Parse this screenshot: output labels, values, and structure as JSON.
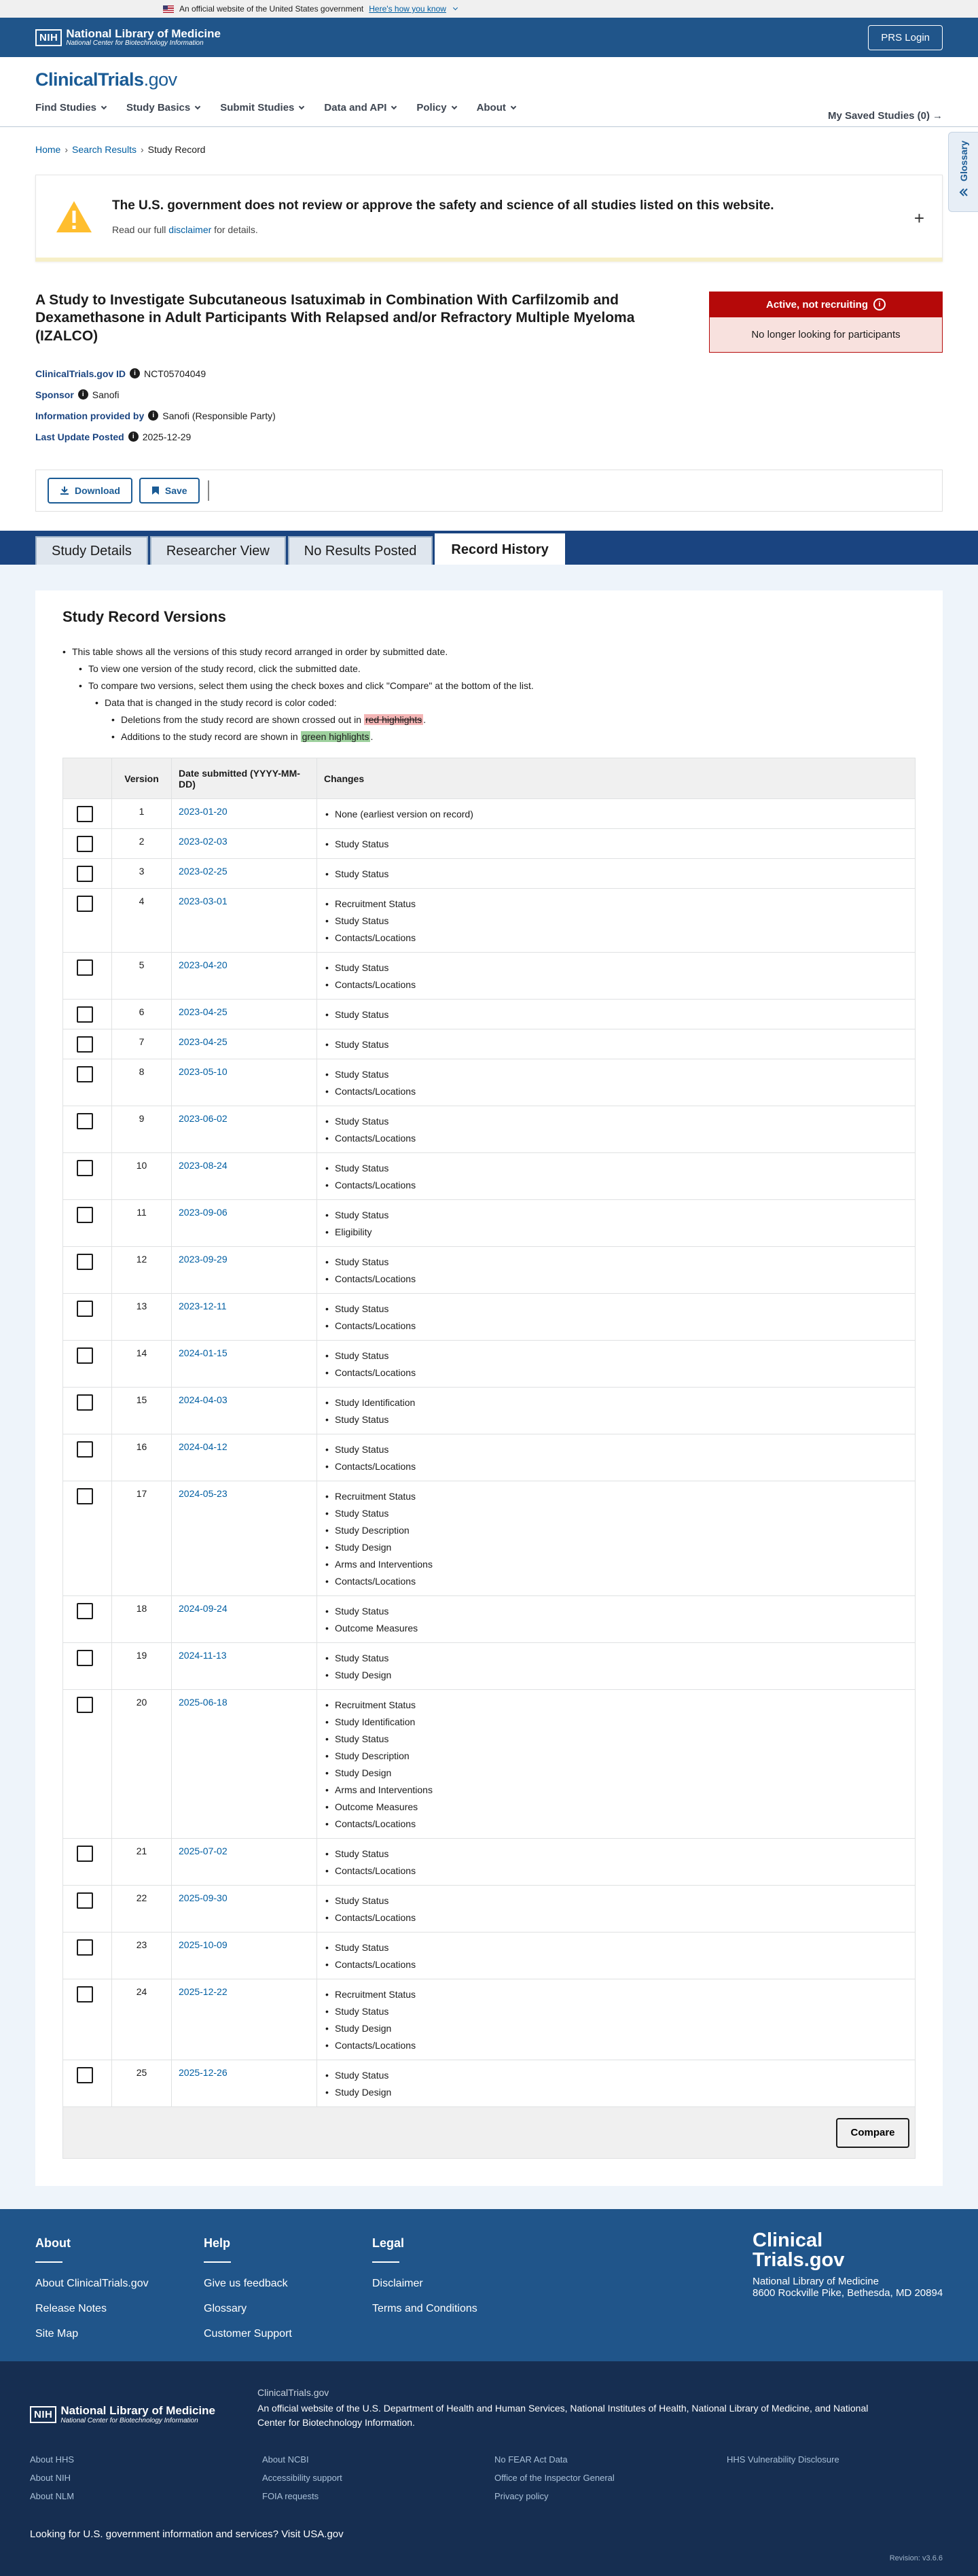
{
  "gov_banner": {
    "text": "An official website of the United States government",
    "link": "Here's how you know"
  },
  "nlm": {
    "nih": "NIH",
    "title": "National Library of Medicine",
    "subtitle": "National Center for Biotechnology Information",
    "prs_button": "PRS Login"
  },
  "ct": {
    "logo_main": "ClinicalTrials",
    "logo_gov": ".gov",
    "nav": [
      "Find Studies",
      "Study Basics",
      "Submit Studies",
      "Data and API",
      "Policy",
      "About"
    ],
    "saved": "My Saved Studies (0)",
    "saved_arrow": "→",
    "glossary": "Glossary"
  },
  "breadcrumb": {
    "home": "Home",
    "search": "Search Results",
    "current": "Study Record"
  },
  "alert": {
    "title": "The U.S. government does not review or approve the safety and science of all studies listed on this website.",
    "pre": "Read our full ",
    "link": "disclaimer",
    "post": " for details.",
    "expand": "+"
  },
  "study": {
    "title": "A Study to Investigate Subcutaneous Isatuximab in Combination With Carfilzomib and Dexamethasone in Adult Participants With Relapsed and/or Refractory Multiple Myeloma (IZALCO)",
    "status": "Active, not recruiting",
    "status_sub": "No longer looking for participants",
    "id_label": "ClinicalTrials.gov ID",
    "id_value": "NCT05704049",
    "sponsor_label": "Sponsor",
    "sponsor_value": "Sanofi",
    "info_label": "Information provided by",
    "info_value": "Sanofi (Responsible Party)",
    "update_label": "Last Update Posted",
    "update_value": "2025-12-29"
  },
  "actions": {
    "download": "Download",
    "save": "Save"
  },
  "tabs": [
    "Study Details",
    "Researcher View",
    "No Results Posted",
    "Record History"
  ],
  "versions_section": {
    "heading": "Study Record Versions",
    "intro1": "This table shows all the versions of this study record arranged in order by submitted date.",
    "intro2": "To view one version of the study record, click the submitted date.",
    "intro3": "To compare two versions, select them using the check boxes and click \"Compare\" at the bottom of the list.",
    "intro4": "Data that is changed in the study record is color coded:",
    "intro5_pre": "Deletions from the study record are shown crossed out in ",
    "intro5_hl": "red highlights",
    "intro5_post": ".",
    "intro6_pre": "Additions to the study record are shown in ",
    "intro6_hl": "green highlights",
    "intro6_post": ".",
    "col_version": "Version",
    "col_date": "Date submitted (YYYY-MM-DD)",
    "col_changes": "Changes",
    "compare": "Compare",
    "rows": [
      {
        "v": "1",
        "d": "2023-01-20",
        "c": [
          "None (earliest version on record)"
        ]
      },
      {
        "v": "2",
        "d": "2023-02-03",
        "c": [
          "Study Status"
        ]
      },
      {
        "v": "3",
        "d": "2023-02-25",
        "c": [
          "Study Status"
        ]
      },
      {
        "v": "4",
        "d": "2023-03-01",
        "c": [
          "Recruitment Status",
          "Study Status",
          "Contacts/Locations"
        ]
      },
      {
        "v": "5",
        "d": "2023-04-20",
        "c": [
          "Study Status",
          "Contacts/Locations"
        ]
      },
      {
        "v": "6",
        "d": "2023-04-25",
        "c": [
          "Study Status"
        ]
      },
      {
        "v": "7",
        "d": "2023-04-25",
        "c": [
          "Study Status"
        ]
      },
      {
        "v": "8",
        "d": "2023-05-10",
        "c": [
          "Study Status",
          "Contacts/Locations"
        ]
      },
      {
        "v": "9",
        "d": "2023-06-02",
        "c": [
          "Study Status",
          "Contacts/Locations"
        ]
      },
      {
        "v": "10",
        "d": "2023-08-24",
        "c": [
          "Study Status",
          "Contacts/Locations"
        ]
      },
      {
        "v": "11",
        "d": "2023-09-06",
        "c": [
          "Study Status",
          "Eligibility"
        ]
      },
      {
        "v": "12",
        "d": "2023-09-29",
        "c": [
          "Study Status",
          "Contacts/Locations"
        ]
      },
      {
        "v": "13",
        "d": "2023-12-11",
        "c": [
          "Study Status",
          "Contacts/Locations"
        ]
      },
      {
        "v": "14",
        "d": "2024-01-15",
        "c": [
          "Study Status",
          "Contacts/Locations"
        ]
      },
      {
        "v": "15",
        "d": "2024-04-03",
        "c": [
          "Study Identification",
          "Study Status"
        ]
      },
      {
        "v": "16",
        "d": "2024-04-12",
        "c": [
          "Study Status",
          "Contacts/Locations"
        ]
      },
      {
        "v": "17",
        "d": "2024-05-23",
        "c": [
          "Recruitment Status",
          "Study Status",
          "Study Description",
          "Study Design",
          "Arms and Interventions",
          "Contacts/Locations"
        ]
      },
      {
        "v": "18",
        "d": "2024-09-24",
        "c": [
          "Study Status",
          "Outcome Measures"
        ]
      },
      {
        "v": "19",
        "d": "2024-11-13",
        "c": [
          "Study Status",
          "Study Design"
        ]
      },
      {
        "v": "20",
        "d": "2025-06-18",
        "c": [
          "Recruitment Status",
          "Study Identification",
          "Study Status",
          "Study Description",
          "Study Design",
          "Arms and Interventions",
          "Outcome Measures",
          "Contacts/Locations"
        ]
      },
      {
        "v": "21",
        "d": "2025-07-02",
        "c": [
          "Study Status",
          "Contacts/Locations"
        ]
      },
      {
        "v": "22",
        "d": "2025-09-30",
        "c": [
          "Study Status",
          "Contacts/Locations"
        ]
      },
      {
        "v": "23",
        "d": "2025-10-09",
        "c": [
          "Study Status",
          "Contacts/Locations"
        ]
      },
      {
        "v": "24",
        "d": "2025-12-22",
        "c": [
          "Recruitment Status",
          "Study Status",
          "Study Design",
          "Contacts/Locations"
        ]
      },
      {
        "v": "25",
        "d": "2025-12-26",
        "c": [
          "Study Status",
          "Study Design"
        ]
      }
    ]
  },
  "footer": {
    "cols": [
      {
        "title": "About",
        "links": [
          "About ClinicalTrials.gov",
          "Release Notes",
          "Site Map"
        ]
      },
      {
        "title": "Help",
        "links": [
          "Give us feedback",
          "Glossary",
          "Customer Support"
        ]
      },
      {
        "title": "Legal",
        "links": [
          "Disclaimer",
          "Terms and Conditions"
        ]
      }
    ],
    "logo_line1": "Clinical",
    "logo_line2": "Trials.gov",
    "addr1": "National Library of Medicine",
    "addr2": "8600 Rockville Pike, Bethesda, MD 20894"
  },
  "footer_bottom": {
    "ct_label": "ClinicalTrials.gov",
    "official_pre": "An official website of the ",
    "hhs": "U.S. Department of Health and Human Services",
    "sep1": ", ",
    "nih": "National Institutes of Health",
    "sep2": ", ",
    "nlm": "National Library of Medicine",
    "sep3": ", and ",
    "ncbi": "National Center for Biotechnology Information",
    "end": ".",
    "links": [
      [
        "About HHS",
        "About NIH",
        "About NLM"
      ],
      [
        "About NCBI",
        "Accessibility support",
        "FOIA requests"
      ],
      [
        "No FEAR Act Data",
        "Office of the Inspector General",
        "Privacy policy"
      ],
      [
        "HHS Vulnerability Disclosure"
      ]
    ],
    "looking_pre": "Looking for U.S. government information and services? ",
    "looking_link": "Visit USA.gov",
    "revision": "Revision: v3.6.6"
  },
  "colors": {
    "primary": "#20558a",
    "status_red": "#b50909",
    "link": "#005ea2",
    "footer_dark": "#162e51"
  }
}
